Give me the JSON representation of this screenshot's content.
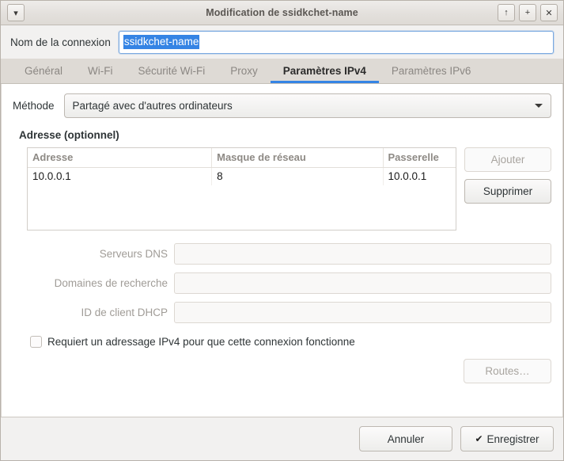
{
  "window": {
    "title": "Modification de ssidkchet-name",
    "menu_button_icon": "chevron-down-icon",
    "maximize_icon": "arrow-up-icon",
    "restore_icon": "plus-icon",
    "close_icon": "close-icon",
    "accent_color": "#3584e4",
    "selection_color": "#3584e4"
  },
  "connection": {
    "name_label": "Nom de la connexion",
    "name_value": "ssidkchet-name"
  },
  "tabs": [
    {
      "label": "Général",
      "active": false
    },
    {
      "label": "Wi-Fi",
      "active": false
    },
    {
      "label": "Sécurité Wi-Fi",
      "active": false
    },
    {
      "label": "Proxy",
      "active": false
    },
    {
      "label": "Paramètres IPv4",
      "active": true
    },
    {
      "label": "Paramètres IPv6",
      "active": false
    }
  ],
  "ipv4": {
    "method_label": "Méthode",
    "method_value": "Partagé avec d'autres ordinateurs",
    "method_caret_icon": "chevron-down-icon",
    "address_section_title": "Adresse (optionnel)",
    "table": {
      "columns": [
        "Adresse",
        "Masque de réseau",
        "Passerelle"
      ],
      "rows": [
        [
          "10.0.0.1",
          "8",
          "10.0.0.1"
        ]
      ]
    },
    "add_button": "Ajouter",
    "add_button_disabled": true,
    "delete_button": "Supprimer",
    "delete_button_disabled": false,
    "fields": [
      {
        "label": "Serveurs DNS",
        "value": "",
        "disabled": true
      },
      {
        "label": "Domaines de recherche",
        "value": "",
        "disabled": true
      },
      {
        "label": "ID de client DHCP",
        "value": "",
        "disabled": true
      }
    ],
    "require_ipv4_label": "Requiert un adressage IPv4 pour que cette connexion fonctionne",
    "require_ipv4_checked": false,
    "routes_button": "Routes…",
    "routes_button_disabled": true
  },
  "actions": {
    "cancel_label": "Annuler",
    "save_label": "Enregistrer",
    "save_icon": "check-icon"
  }
}
